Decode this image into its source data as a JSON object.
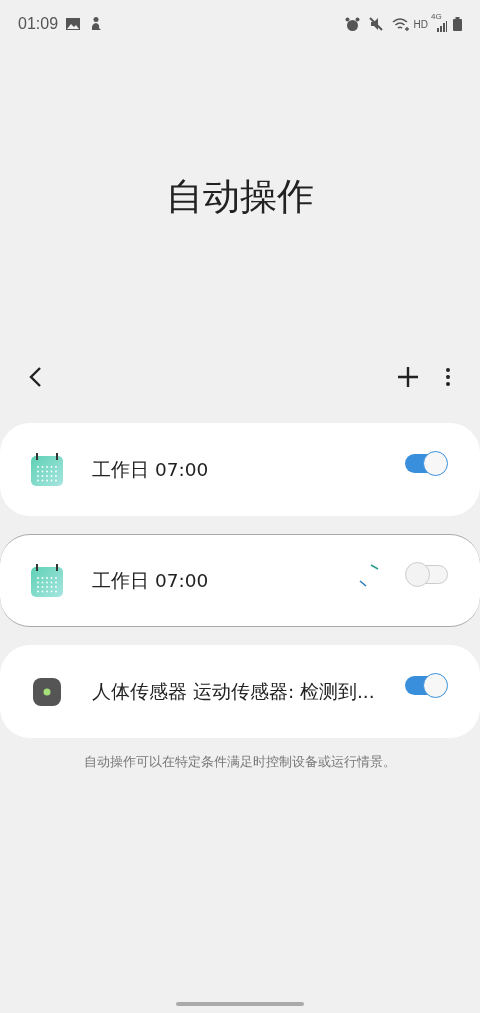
{
  "status_bar": {
    "time": "01:09",
    "hd_label": "HD",
    "network_label": "4G"
  },
  "title": "自动操作",
  "automations": [
    {
      "kind": "calendar",
      "label": "工作日 07:00",
      "on": true,
      "loading": false
    },
    {
      "kind": "calendar",
      "label": "工作日 07:00",
      "on": false,
      "loading": true
    },
    {
      "kind": "sensor",
      "label": "人体传感器 运动传感器: 检测到...",
      "on": true,
      "loading": false
    }
  ],
  "footer_note": "自动操作可以在特定条件满足时控制设备或运行情景。"
}
